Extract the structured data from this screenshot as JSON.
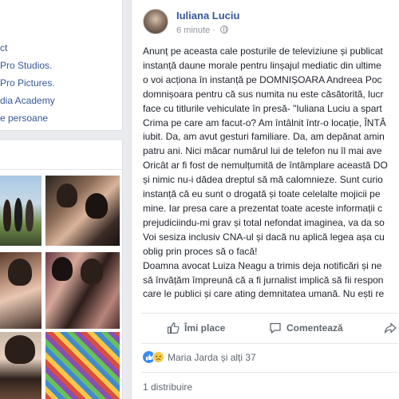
{
  "left": {
    "links": [
      "ct",
      "Pro Studios.",
      "Pro Pictures.",
      "dia Academy",
      "e persoane"
    ]
  },
  "post": {
    "author": "Iuliana Luciu",
    "time": "6 minute",
    "time_separator": "·",
    "lines": [
      "Anunț pe aceasta cale posturile de televiziune și publicat",
      "instanță daune morale pentru linșajul mediatic din ultime",
      "o voi acționa în instanță pe DOMNIȘOARA Andreea Poc",
      "domnișoara pentru că sus numita nu este căsătorită, lucr",
      "face cu titlurile vehiculate în presă- \"Iuliana Luciu a spart",
      "Crima pe care am facut-o? Am întâlnit într-o locație, ÎNTÂ",
      "iubit. Da, am avut gesturi familiare. Da, am depănat amin",
      "patru ani. Nici măcar numărul lui de telefon nu îl mai ave",
      "Oricât ar fi fost de nemulțumită de întâmplare această DO",
      "și nimic nu-i dădea dreptul să mă calomnieze. Sunt curio",
      "instanță că eu sunt o drogată și toate celelalte mojicii pe",
      "mine. Iar presa care a prezentat toate aceste informații c",
      "prejudiciindu-mi grav și total nefondat imaginea, va da so",
      "Voi sesiza inclusiv CNA-ul și dacă nu aplică legea așa cu",
      "oblig prin proces să o facă!",
      "Doamna avocat Luiza Neagu a trimis deja notificări și ne",
      "să învățăm împreună că a fi jurnalist implică să fii respon",
      "care le publici și care ating demnitatea umană. Nu ești re"
    ],
    "actions": {
      "like": "Îmi place",
      "comment": "Comentează"
    },
    "reactions": {
      "names": "Maria Jarda și alți 37"
    },
    "shares": "1 distribuire"
  },
  "colors": {
    "link": "#365899",
    "like_blue": "#3b8cf2",
    "sad_yellow": "#f7c948"
  }
}
